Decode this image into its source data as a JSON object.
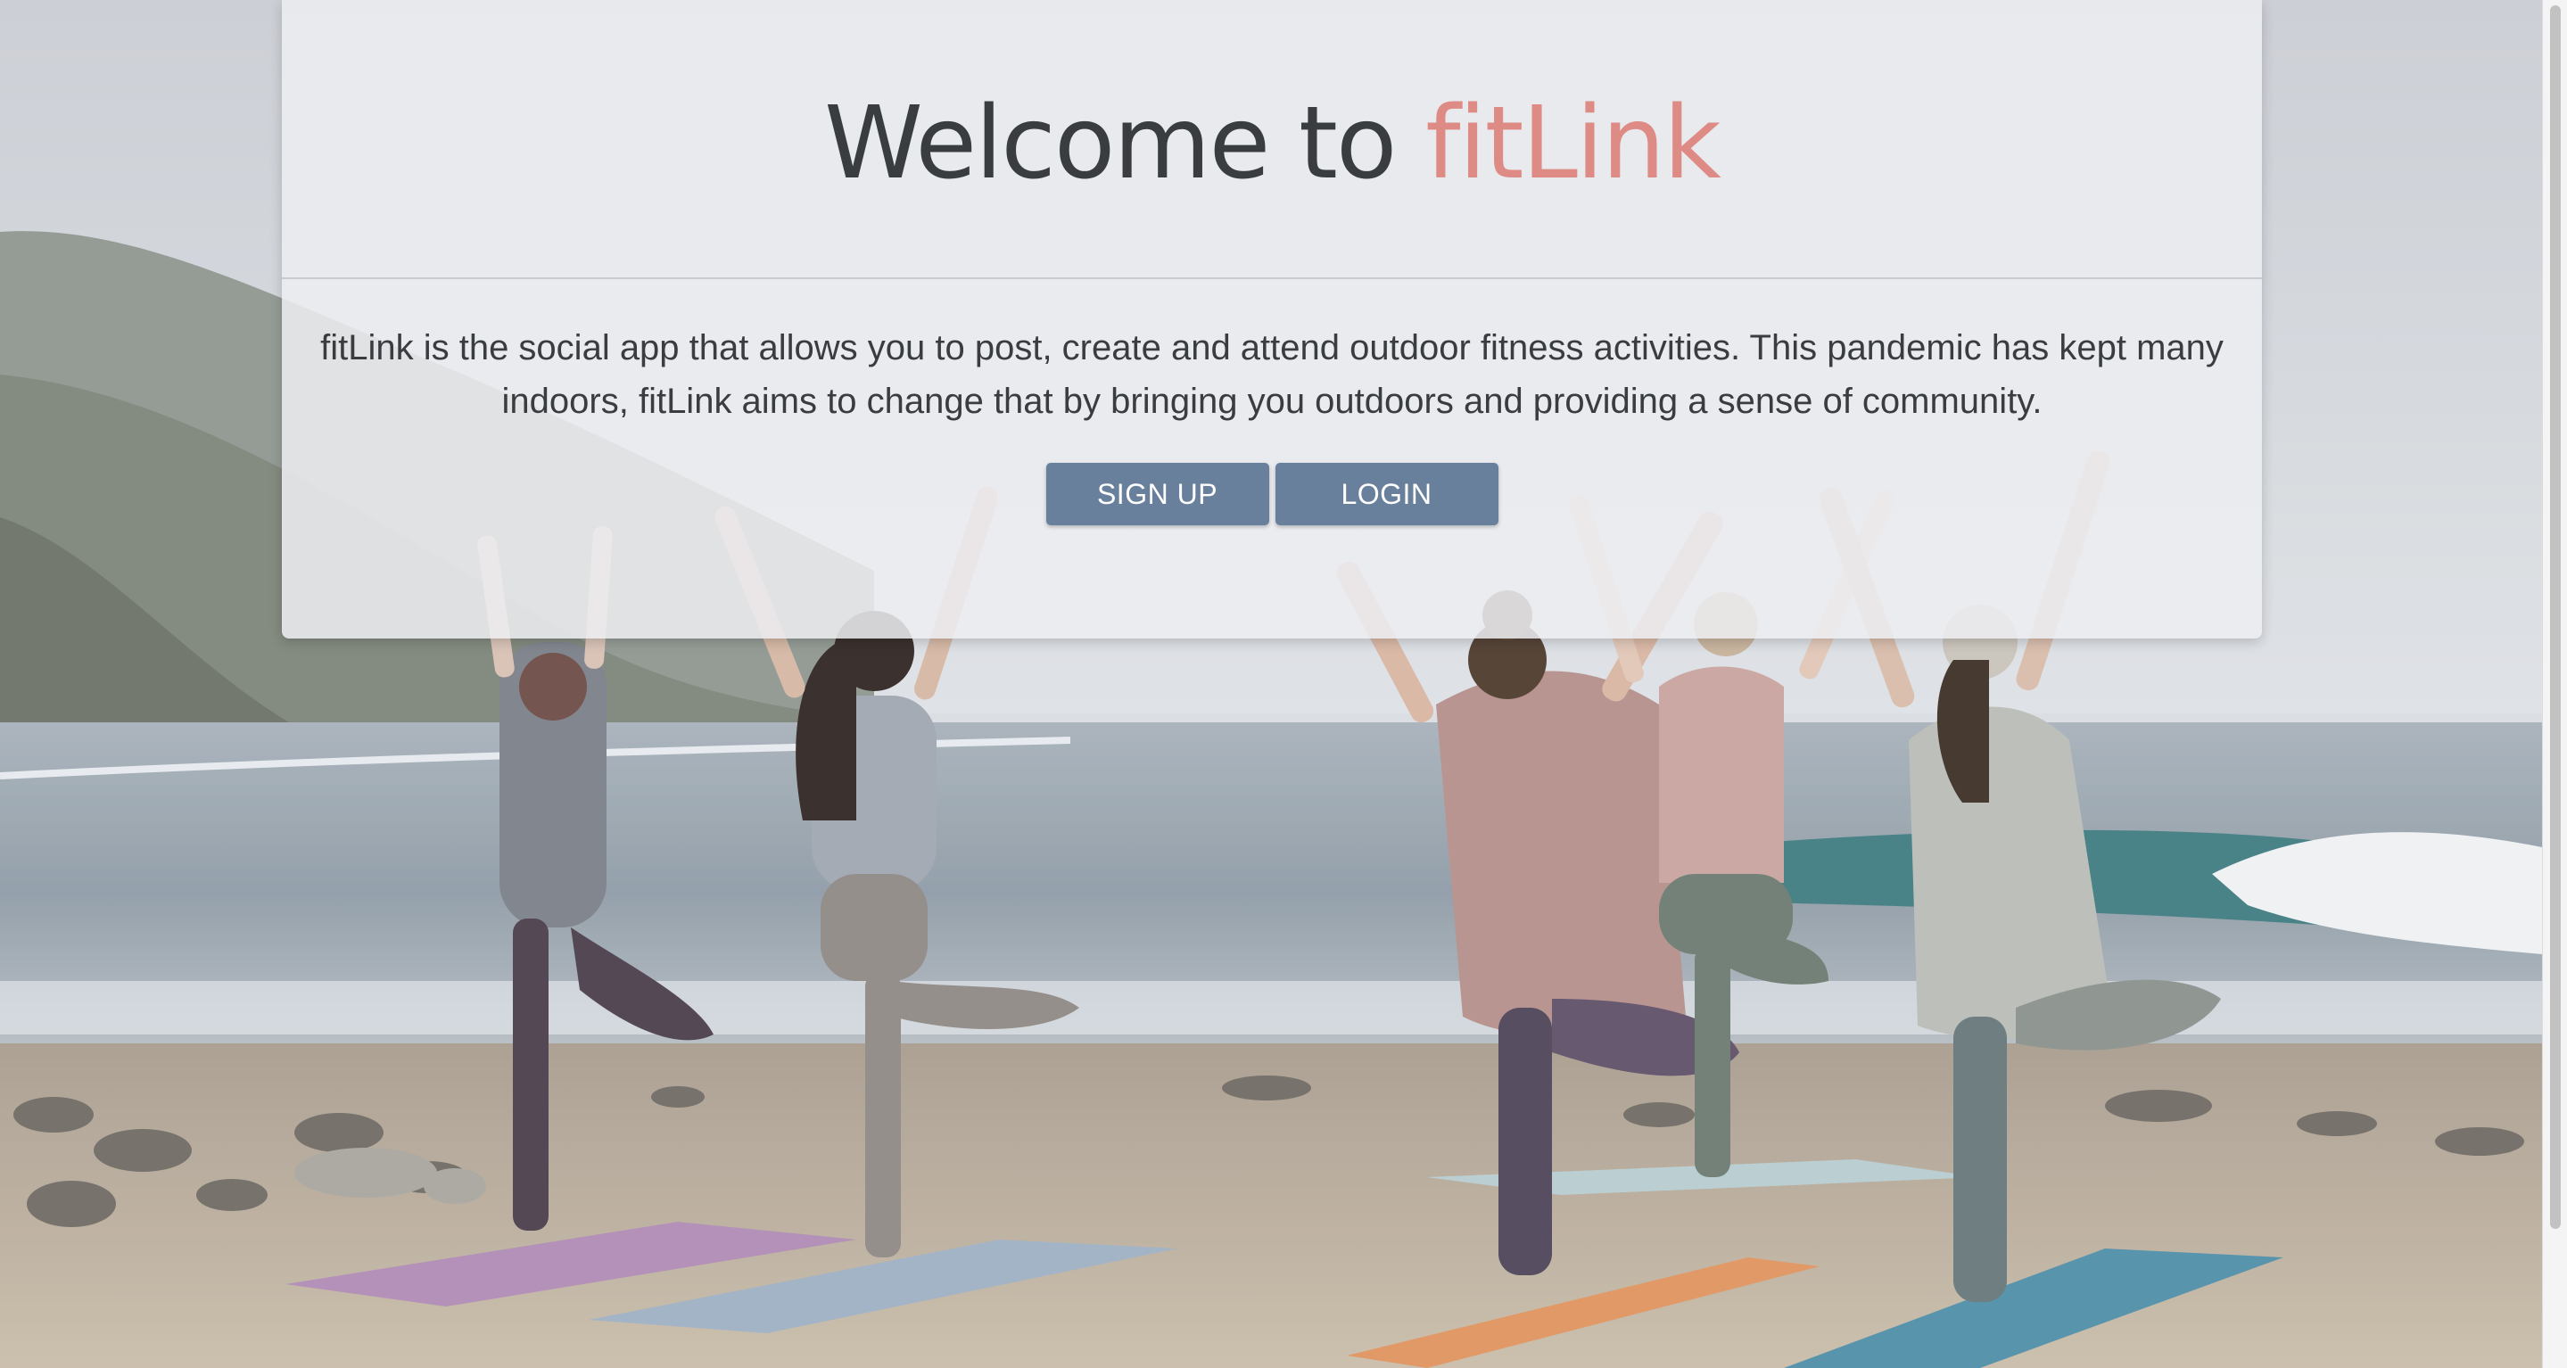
{
  "hero": {
    "headline_prefix": "Welcome to",
    "brand_name": "fitLink",
    "description": "fitLink is the social app that allows you to post, create and attend outdoor fitness activities. This pandemic has kept many indoors, fitLink aims to change that by bringing you outdoors and providing a sense of community."
  },
  "actions": {
    "signup_label": "SIGN UP",
    "login_label": "LOGIN"
  },
  "colors": {
    "brand_accent": "#de8b86",
    "button_bg": "#69809d",
    "text_primary": "#3a3d40",
    "card_bg": "#eceef1"
  }
}
